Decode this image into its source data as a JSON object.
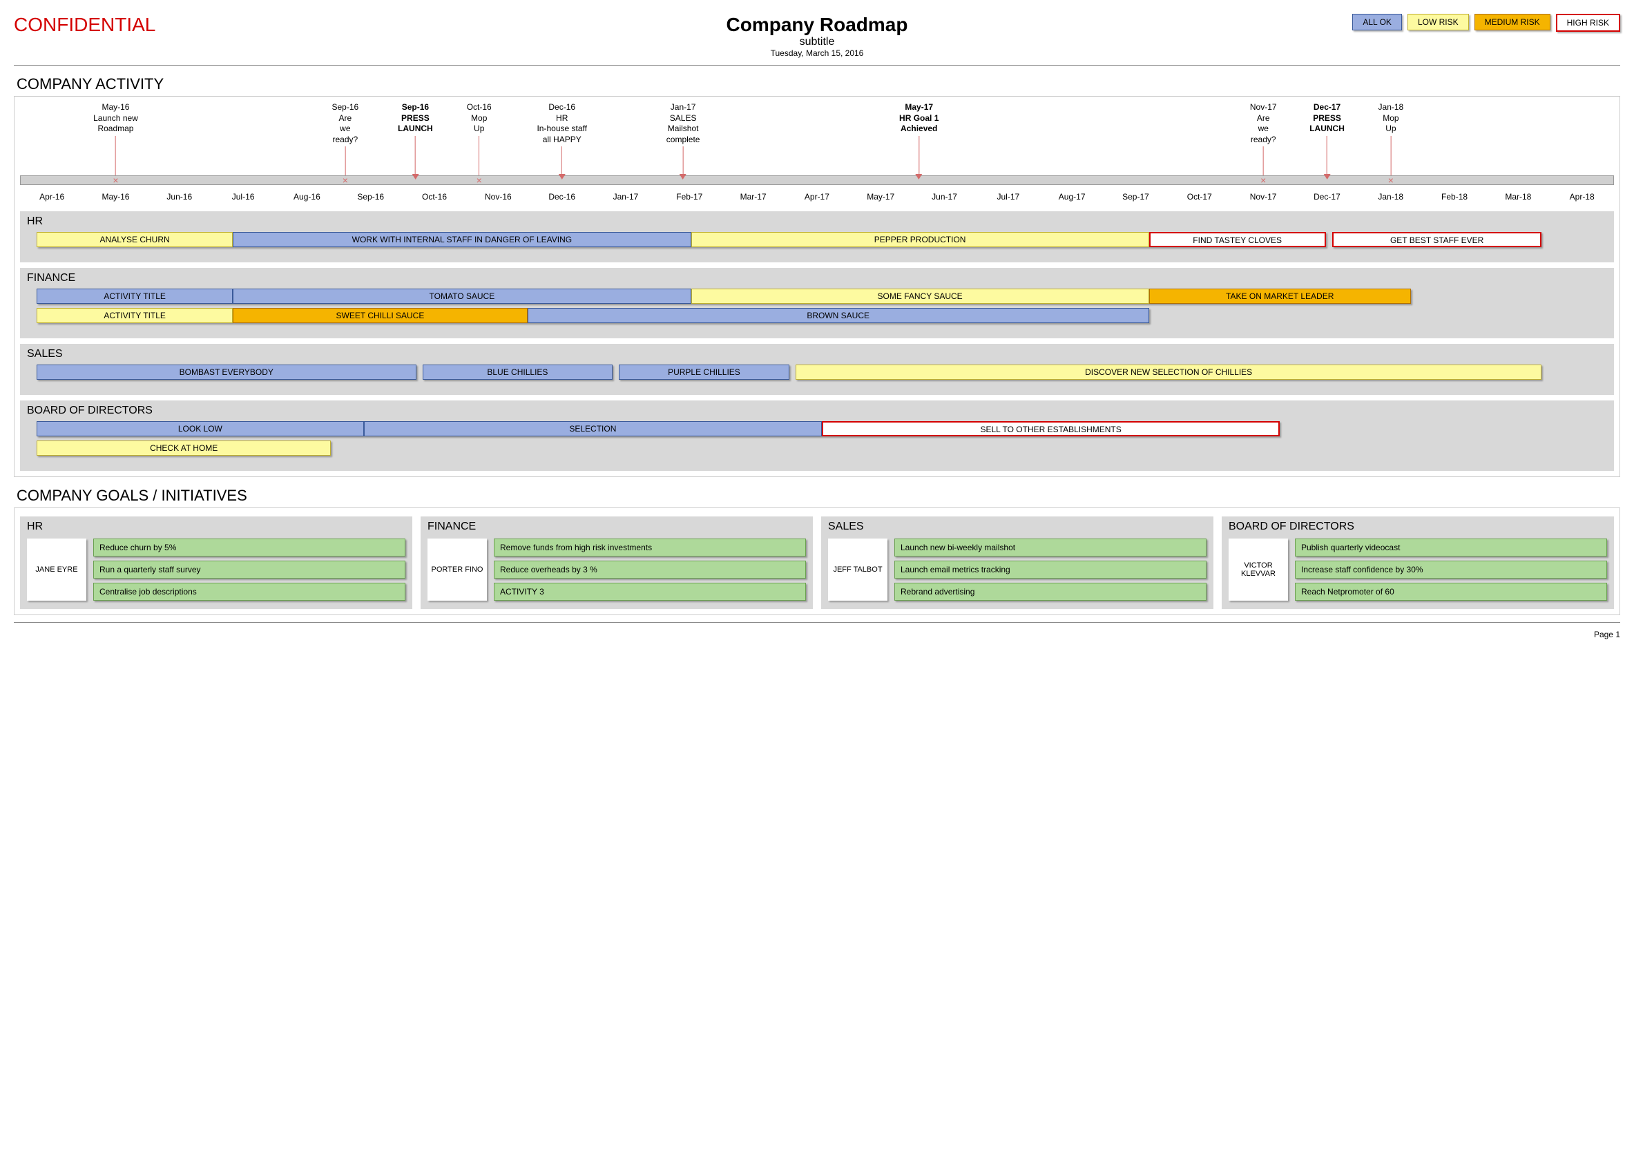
{
  "header": {
    "confidential": "CONFIDENTIAL",
    "title": "Company Roadmap",
    "subtitle": "subtitle",
    "date": "Tuesday, March 15, 2016"
  },
  "legend": {
    "ok": "ALL OK",
    "low": "LOW RISK",
    "medium": "MEDIUM RISK",
    "high": "HIGH RISK"
  },
  "sections": {
    "activity_title": "COMPANY ACTIVITY",
    "goals_title": "COMPANY GOALS / INITIATIVES"
  },
  "timeline": {
    "start": "Apr-16",
    "end": "Apr-18",
    "months": [
      "Apr-16",
      "May-16",
      "Jun-16",
      "Jul-16",
      "Aug-16",
      "Sep-16",
      "Oct-16",
      "Nov-16",
      "Dec-16",
      "Jan-17",
      "Feb-17",
      "Mar-17",
      "Apr-17",
      "May-17",
      "Jun-17",
      "Jul-17",
      "Aug-17",
      "Sep-17",
      "Oct-17",
      "Nov-17",
      "Dec-17",
      "Jan-18",
      "Feb-18",
      "Mar-18",
      "Apr-18"
    ],
    "milestones": [
      {
        "month": "May-16",
        "lines": [
          "May-16",
          "Launch new",
          "Roadmap"
        ],
        "bold": false,
        "marker": "x"
      },
      {
        "month": "Sep-16",
        "lines": [
          "Sep-16",
          "Are",
          "we",
          "ready?"
        ],
        "bold": false,
        "marker": "x",
        "offset": -0.4
      },
      {
        "month": "Sep-16",
        "lines": [
          "Sep-16",
          "PRESS",
          "LAUNCH"
        ],
        "bold": true,
        "marker": "arrow",
        "offset": 0.7
      },
      {
        "month": "Oct-16",
        "lines": [
          "Oct-16",
          "Mop",
          "Up"
        ],
        "bold": false,
        "marker": "x",
        "offset": 0.7
      },
      {
        "month": "Dec-16",
        "lines": [
          "Dec-16",
          "HR",
          "In-house staff",
          "all HAPPY"
        ],
        "bold": false,
        "marker": "arrow"
      },
      {
        "month": "Jan-17",
        "lines": [
          "Jan-17",
          "SALES",
          "Mailshot",
          "complete"
        ],
        "bold": false,
        "marker": "arrow",
        "offset": 0.9
      },
      {
        "month": "May-17",
        "lines": [
          "May-17",
          "HR Goal 1",
          "Achieved"
        ],
        "bold": true,
        "marker": "arrow",
        "offset": 0.6
      },
      {
        "month": "Nov-17",
        "lines": [
          "Nov-17",
          "Are",
          "we",
          "ready?"
        ],
        "bold": false,
        "marker": "x"
      },
      {
        "month": "Dec-17",
        "lines": [
          "Dec-17",
          "PRESS",
          "LAUNCH"
        ],
        "bold": true,
        "marker": "arrow"
      },
      {
        "month": "Jan-18",
        "lines": [
          "Jan-18",
          "Mop",
          "Up"
        ],
        "bold": false,
        "marker": "x"
      }
    ]
  },
  "departments": [
    {
      "name": "HR",
      "rows": [
        [
          {
            "label": "ANALYSE CHURN",
            "risk": "low",
            "start": 0,
            "end": 3
          },
          {
            "label": "WORK WITH INTERNAL STAFF IN DANGER OF LEAVING",
            "risk": "ok",
            "start": 3,
            "end": 10
          },
          {
            "label": "PEPPER PRODUCTION",
            "risk": "low",
            "start": 10,
            "end": 17
          },
          {
            "label": "FIND TASTEY CLOVES",
            "risk": "high",
            "start": 17,
            "end": 19.7
          },
          {
            "label": "GET BEST STAFF EVER",
            "risk": "high",
            "start": 19.8,
            "end": 23
          }
        ]
      ]
    },
    {
      "name": "FINANCE",
      "rows": [
        [
          {
            "label": "ACTIVITY TITLE",
            "risk": "ok",
            "start": 0,
            "end": 3
          },
          {
            "label": "TOMATO SAUCE",
            "risk": "ok",
            "start": 3,
            "end": 10
          },
          {
            "label": "SOME FANCY SAUCE",
            "risk": "low",
            "start": 10,
            "end": 17
          },
          {
            "label": "TAKE ON MARKET LEADER",
            "risk": "medium",
            "start": 17,
            "end": 21
          }
        ],
        [
          {
            "label": "ACTIVITY TITLE",
            "risk": "low",
            "start": 0,
            "end": 3
          },
          {
            "label": "SWEET CHILLI SAUCE",
            "risk": "medium",
            "start": 3,
            "end": 7.5
          },
          {
            "label": "BROWN SAUCE",
            "risk": "ok",
            "start": 7.5,
            "end": 17
          }
        ]
      ]
    },
    {
      "name": "SALES",
      "rows": [
        [
          {
            "label": "BOMBAST EVERYBODY",
            "risk": "ok",
            "start": 0,
            "end": 5.8
          },
          {
            "label": "BLUE CHILLIES",
            "risk": "ok",
            "start": 5.9,
            "end": 8.8
          },
          {
            "label": "PURPLE CHILLIES",
            "risk": "ok",
            "start": 8.9,
            "end": 11.5
          },
          {
            "label": "DISCOVER NEW SELECTION OF CHILLIES",
            "risk": "low",
            "start": 11.6,
            "end": 23
          }
        ]
      ]
    },
    {
      "name": "BOARD OF DIRECTORS",
      "rows": [
        [
          {
            "label": "LOOK LOW",
            "risk": "ok",
            "start": 0,
            "end": 5
          },
          {
            "label": "SELECTION",
            "risk": "ok",
            "start": 5,
            "end": 12
          },
          {
            "label": "SELL TO OTHER ESTABLISHMENTS",
            "risk": "high",
            "start": 12,
            "end": 19
          }
        ],
        [
          {
            "label": "CHECK AT HOME",
            "risk": "low",
            "start": 0,
            "end": 4.5
          }
        ]
      ]
    }
  ],
  "goals": [
    {
      "dept": "HR",
      "owner": "JANE EYRE",
      "items": [
        "Reduce churn by 5%",
        "Run a quarterly staff survey",
        "Centralise job descriptions"
      ]
    },
    {
      "dept": "FINANCE",
      "owner": "PORTER FINO",
      "items": [
        "Remove funds from high risk investments",
        "Reduce overheads by 3 %",
        "ACTIVITY 3"
      ]
    },
    {
      "dept": "SALES",
      "owner": "JEFF TALBOT",
      "items": [
        "Launch new bi-weekly mailshot",
        "Launch email metrics tracking",
        "Rebrand advertising"
      ]
    },
    {
      "dept": "BOARD OF DIRECTORS",
      "owner": "VICTOR KLEVVAR",
      "items": [
        "Publish quarterly videocast",
        "Increase staff confidence by 30%",
        "Reach Netpromoter of 60"
      ]
    }
  ],
  "footer": {
    "page": "Page 1"
  }
}
